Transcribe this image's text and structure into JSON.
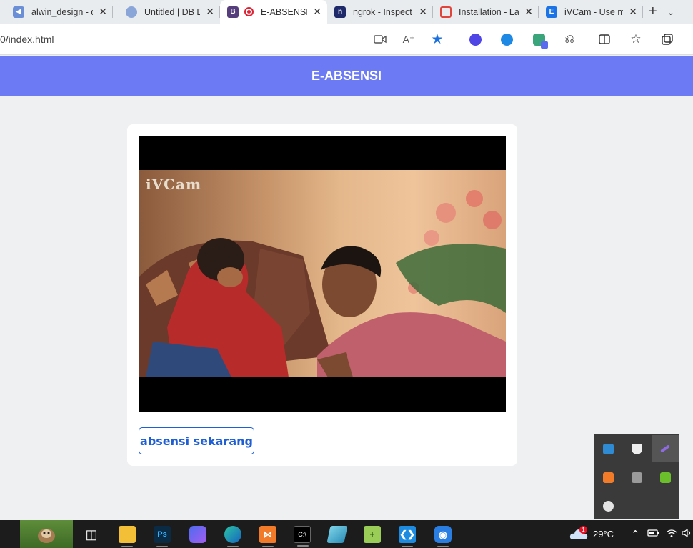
{
  "browser": {
    "tabs": [
      {
        "title": "alwin_design - d",
        "icon": "share-icon",
        "color": "#6b8fd6"
      },
      {
        "title": "Untitled | DB De",
        "icon": "database-icon",
        "color": "#8aa6d8"
      },
      {
        "title": "E-ABSENSI",
        "icon": "bootstrap-icon",
        "color": "#563d7c",
        "active": true
      },
      {
        "title": "ngrok - Inspect",
        "icon": "ngrok-icon",
        "color": "#1f2a6b"
      },
      {
        "title": "Installation - La",
        "icon": "laravel-icon",
        "color": "#e0443b"
      },
      {
        "title": "iVCam - Use mo",
        "icon": "ivcam-icon",
        "color": "#1b73e8"
      }
    ],
    "active_tab_favicon_letter": "B",
    "url": "0/index.html"
  },
  "page": {
    "title": "E-ABSENSI",
    "video_watermark": "iVCam",
    "button_label": "absensi sekarang",
    "header_color": "#6c7af4",
    "button_color": "#1f5fd6"
  },
  "taskbar": {
    "weather_badge": "1",
    "temperature": "29°C"
  }
}
